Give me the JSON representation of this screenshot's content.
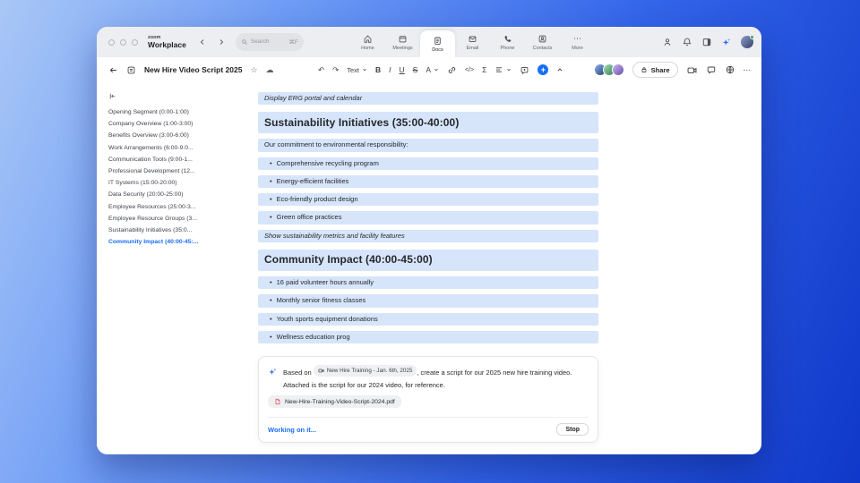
{
  "colors": {
    "accent_blue": "#1a6ef5",
    "highlight_blue": "#d6e5fa",
    "titlebar_gray": "#edeef1",
    "status_green": "#34a853",
    "pdf_red": "#e5484d"
  },
  "titlebar": {
    "logo_top": "zoom",
    "logo_bottom": "Workplace",
    "search": {
      "placeholder": "Search",
      "shortcut": "⌘F"
    },
    "tabs": [
      {
        "id": "home",
        "label": "Home",
        "icon": "home-icon",
        "active": false
      },
      {
        "id": "meetings",
        "label": "Meetings",
        "icon": "calendar-icon",
        "active": false
      },
      {
        "id": "docs",
        "label": "Docs",
        "icon": "document-icon",
        "active": true
      },
      {
        "id": "email",
        "label": "Email",
        "icon": "envelope-icon",
        "active": false
      },
      {
        "id": "phone",
        "label": "Phone",
        "icon": "phone-icon",
        "active": false
      },
      {
        "id": "contacts",
        "label": "Contacts",
        "icon": "contacts-icon",
        "active": false
      },
      {
        "id": "more",
        "label": "More",
        "icon": "ellipsis-icon",
        "active": false
      }
    ]
  },
  "doc_toolbar": {
    "title": "New Hire Video Script 2025",
    "text_style_label": "Text",
    "bold_label": "B",
    "italic_label": "I",
    "underline_label": "U",
    "strike_label": "S",
    "color_label": "A",
    "code_label": "</>",
    "formula_label": "Σ",
    "undo_glyph": "↶",
    "redo_glyph": "↷",
    "star_glyph": "☆",
    "cloud_glyph": "☁",
    "more_glyph": "⋯",
    "share_label": "Share",
    "collaborators": [
      {
        "gradient": [
          "#8ab0f5",
          "#27406e"
        ]
      },
      {
        "gradient": [
          "#9fe0b5",
          "#3f7a55"
        ]
      },
      {
        "gradient": [
          "#c9b5f2",
          "#6b4fa8"
        ]
      }
    ]
  },
  "sidebar": {
    "items": [
      "Opening Segment (0:00-1:00)",
      "Company Overview (1:00-3:00)",
      "Benefits Overview (3:00-6:00)",
      "Work Arrangements (6:00-9:0...",
      "Communication Tools (9:00-1...",
      "Professional Development (12...",
      "IT Systems (15:00-20:00)",
      "Data Security (20:00-25:00)",
      "Employee Resources (25:00-3...",
      "Employee Resource Groups (3...",
      "Sustainability Initiatives (35:0...",
      "Community Impact (40:00-45:..."
    ],
    "active_index": 11
  },
  "document": {
    "blocks": [
      {
        "type": "italic",
        "text": "Display ERG portal and calendar"
      },
      {
        "type": "h",
        "text": "Sustainability Initiatives (35:00-40:00)"
      },
      {
        "type": "p",
        "text": "Our commitment to environmental responsibility:"
      },
      {
        "type": "bullet",
        "text": "Comprehensive recycling program"
      },
      {
        "type": "bullet",
        "text": "Energy-efficient facilities"
      },
      {
        "type": "bullet",
        "text": "Eco-friendly product design"
      },
      {
        "type": "bullet",
        "text": "Green office practices"
      },
      {
        "type": "italic",
        "text": "Show sustainability metrics and facility features"
      },
      {
        "type": "h",
        "text": "Community Impact (40:00-45:00)"
      },
      {
        "type": "bullet",
        "text": "16 paid volunteer hours annually"
      },
      {
        "type": "bullet",
        "text": "Monthly senior fitness classes"
      },
      {
        "type": "bullet",
        "text": "Youth sports equipment donations"
      },
      {
        "type": "bullet",
        "text": "Wellness education prog"
      }
    ]
  },
  "ai_card": {
    "prompt_prefix": "Based on",
    "meeting_chip": "New Hire Training - Jan. 6th, 2025",
    "prompt_suffix": ", create a script for our 2025 new hire training video.",
    "prompt_line2": "Attached is the script for our 2024 video, for reference.",
    "attachment_name": "New-Hire-Training-Video-Script-2024.pdf",
    "status": "Working on it...",
    "stop_label": "Stop"
  }
}
